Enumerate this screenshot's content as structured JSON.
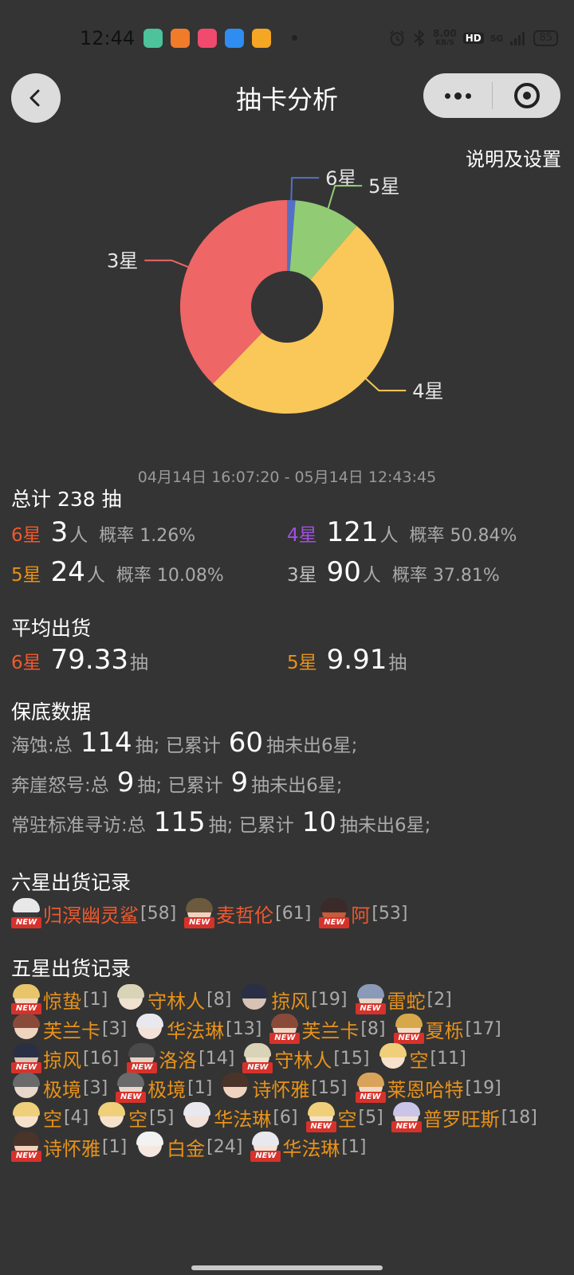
{
  "status_bar": {
    "time": "12:44",
    "net_speed_value": "8.00",
    "net_speed_unit": "KB/S",
    "hd": "HD",
    "signal": "5G",
    "battery": "85",
    "app_colors": [
      "#4cc39a",
      "#f07c2a",
      "#f04a6e",
      "#2f8cf0",
      "#f5a623"
    ]
  },
  "nav": {
    "title": "抽卡分析",
    "settings_label": "说明及设置"
  },
  "chart_data": {
    "type": "pie",
    "categories": [
      "6星",
      "5星",
      "4星",
      "3星"
    ],
    "values": [
      3,
      24,
      121,
      90
    ],
    "colors": [
      "#5470c6",
      "#91cc75",
      "#fac858",
      "#ee6666"
    ],
    "donut": true,
    "labels_outside": true
  },
  "date_range": "04月14日 16:07:20  -  05月14日 12:43:45",
  "summary": {
    "total_label": "总计 238 抽",
    "stats": [
      {
        "star": "6星",
        "count": "3",
        "unit": "人",
        "rate": "概率 1.26%"
      },
      {
        "star": "4星",
        "count": "121",
        "unit": "人",
        "rate": "概率 50.84%"
      },
      {
        "star": "5星",
        "count": "24",
        "unit": "人",
        "rate": "概率 10.08%"
      },
      {
        "star": "3星",
        "count": "90",
        "unit": "人",
        "rate": "概率 37.81%"
      }
    ]
  },
  "average": {
    "heading": "平均出货",
    "six_star": "6星",
    "six_value": "79.33",
    "six_unit": "抽",
    "five_star": "5星",
    "five_value": "9.91",
    "five_unit": "抽"
  },
  "pity": {
    "heading": "保底数据",
    "rows": [
      {
        "pool": "海蚀:总",
        "total": "114",
        "mid": "抽;  已累计",
        "count": "60",
        "tail": "抽未出6星;"
      },
      {
        "pool": "奔崖怒号:总",
        "total": "9",
        "mid": "抽;  已累计",
        "count": "9",
        "tail": "抽未出6星;"
      },
      {
        "pool": "常驻标准寻访:总",
        "total": "115",
        "mid": "抽;  已累计",
        "count": "10",
        "tail": "抽未出6星;"
      }
    ]
  },
  "six_records": {
    "heading": "六星出货记录",
    "items": [
      {
        "name": "归溟幽灵鲨",
        "count": "[58]",
        "is_new": true,
        "hair": "#e8e8e8",
        "face": "#3a3a3a"
      },
      {
        "name": "麦哲伦",
        "count": "[61]",
        "is_new": true,
        "hair": "#6b5a3e",
        "face": "#f2d2bd"
      },
      {
        "name": "阿",
        "count": "[53]",
        "is_new": true,
        "hair": "#3a2a2a",
        "face": "#c95b3a"
      }
    ]
  },
  "five_records": {
    "heading": "五星出货记录",
    "badge_text": "NEW",
    "items": [
      {
        "name": "惊蛰",
        "count": "[1]",
        "is_new": true,
        "hair": "#e8c56a",
        "face": "#f3dcc6"
      },
      {
        "name": "守林人",
        "count": "[8]",
        "is_new": false,
        "hair": "#d9d3b8",
        "face": "#efe2cf"
      },
      {
        "name": "掠风",
        "count": "[19]",
        "is_new": false,
        "hair": "#2a2f45",
        "face": "#d7c2b4"
      },
      {
        "name": "雷蛇",
        "count": "[2]",
        "is_new": true,
        "hair": "#8a9ab8",
        "face": "#e8d5c5"
      },
      {
        "name": "芙兰卡",
        "count": "[3]",
        "is_new": false,
        "hair": "#8a4a3a",
        "face": "#efd4c0"
      },
      {
        "name": "华法琳",
        "count": "[13]",
        "is_new": false,
        "hair": "#e8e8ee",
        "face": "#f3e2d8"
      },
      {
        "name": "芙兰卡",
        "count": "[8]",
        "is_new": true,
        "hair": "#8a4a3a",
        "face": "#efd4c0"
      },
      {
        "name": "夏栎",
        "count": "[17]",
        "is_new": true,
        "hair": "#d6a84a",
        "face": "#f3dcc6"
      },
      {
        "name": "掠风",
        "count": "[16]",
        "is_new": true,
        "hair": "#2a2f45",
        "face": "#d7c2b4"
      },
      {
        "name": "洛洛",
        "count": "[14]",
        "is_new": true,
        "hair": "#4a4a4a",
        "face": "#e6d2c4"
      },
      {
        "name": "守林人",
        "count": "[15]",
        "is_new": true,
        "hair": "#d9d3b8",
        "face": "#efe2cf"
      },
      {
        "name": "空",
        "count": "[11]",
        "is_new": false,
        "hair": "#efcf7a",
        "face": "#f6e2cc"
      },
      {
        "name": "极境",
        "count": "[3]",
        "is_new": false,
        "hair": "#6a6a6a",
        "face": "#e8d8cc"
      },
      {
        "name": "极境",
        "count": "[1]",
        "is_new": true,
        "hair": "#6a6a6a",
        "face": "#e8d8cc"
      },
      {
        "name": "诗怀雅",
        "count": "[15]",
        "is_new": false,
        "hair": "#4a3328",
        "face": "#f0d4bf"
      },
      {
        "name": "莱恩哈特",
        "count": "[19]",
        "is_new": true,
        "hair": "#d9a35a",
        "face": "#f1d8c2"
      },
      {
        "name": "空",
        "count": "[4]",
        "is_new": false,
        "hair": "#efcf7a",
        "face": "#f6e2cc"
      },
      {
        "name": "空",
        "count": "[5]",
        "is_new": false,
        "hair": "#efcf7a",
        "face": "#f6e2cc"
      },
      {
        "name": "华法琳",
        "count": "[6]",
        "is_new": false,
        "hair": "#e8e8ee",
        "face": "#f3e2d8"
      },
      {
        "name": "空",
        "count": "[5]",
        "is_new": true,
        "hair": "#efcf7a",
        "face": "#f6e2cc"
      },
      {
        "name": "普罗旺斯",
        "count": "[18]",
        "is_new": true,
        "hair": "#c9c4e8",
        "face": "#f1e2d8"
      },
      {
        "name": "诗怀雅",
        "count": "[1]",
        "is_new": true,
        "hair": "#4a3328",
        "face": "#f0d4bf"
      },
      {
        "name": "白金",
        "count": "[24]",
        "is_new": false,
        "hair": "#f2f2f2",
        "face": "#f6e8de"
      },
      {
        "name": "华法琳",
        "count": "[1]",
        "is_new": true,
        "hair": "#e8e8ee",
        "face": "#f3e2d8"
      }
    ]
  }
}
